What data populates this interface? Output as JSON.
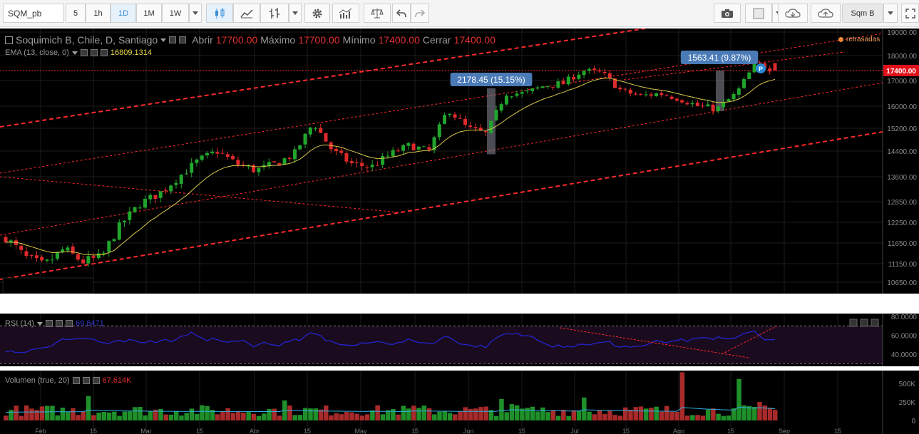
{
  "toolbar": {
    "symbol": "SQM_pb",
    "intervals": [
      "5",
      "1h",
      "1D",
      "1M",
      "1W"
    ],
    "active_interval": "1D",
    "compare_label": "Sqm B"
  },
  "chart": {
    "title": "Soquimich B, Chile, D, Santiago",
    "ohlc": [
      {
        "label": "Abrir",
        "value": "17700.00"
      },
      {
        "label": "Máximo",
        "value": "17700.00"
      },
      {
        "label": "Mínimo",
        "value": "17400.00"
      },
      {
        "label": "Cerrar",
        "value": "17400.00"
      }
    ],
    "ema_label": "EMA (13, close, 0)",
    "ema_value": "16809.1314",
    "delayed_label": "retrasadas",
    "last_price_label": "17400.00",
    "measure_1": "2178.45 (15.15%)",
    "measure_2": "1563.41 (9.87%)",
    "marker_label": "P",
    "rsi_label": "RSI (14)",
    "rsi_value": "69.8471",
    "vol_label": "Volumen (true, 20)",
    "vol_value": "67.614K",
    "colors": {
      "up": "#21a52c",
      "down": "#e02a2a",
      "ema": "#d9c84a",
      "rsi": "#2424d0",
      "channel": "#ff2a2a",
      "bg": "#000000"
    }
  },
  "chart_data": {
    "type": "candlestick",
    "title": "Soquimich B, Chile, D, Santiago",
    "x_ticks": [
      "Feb",
      "15",
      "Mar",
      "15",
      "Abr",
      "15",
      "May",
      "15",
      "Jun",
      "15",
      "Jul",
      "15",
      "Ago",
      "15",
      "Sep",
      "15"
    ],
    "y_ticks": [
      "19000.00",
      "18000.00",
      "17000.00",
      "16000.00",
      "15200.00",
      "14400.00",
      "13600.00",
      "12850.00",
      "12250.00",
      "11650.00",
      "11150.00",
      "10650.00"
    ],
    "rsi_ticks": [
      "80.0000",
      "60.0000",
      "40.0000"
    ],
    "vol_ticks": [
      "500K",
      "250K",
      "0"
    ],
    "approx_close_path": [
      11800,
      11300,
      11100,
      11500,
      11200,
      11300,
      12200,
      12800,
      13100,
      13600,
      14100,
      14400,
      14000,
      13800,
      14000,
      14300,
      15400,
      14400,
      14000,
      13900,
      14300,
      14600,
      14400,
      15900,
      15200,
      15000,
      16500,
      16500,
      16800,
      16900,
      17400,
      17300,
      16600,
      16400,
      16500,
      16300,
      16000,
      15900,
      16500,
      17700,
      17400
    ]
  }
}
